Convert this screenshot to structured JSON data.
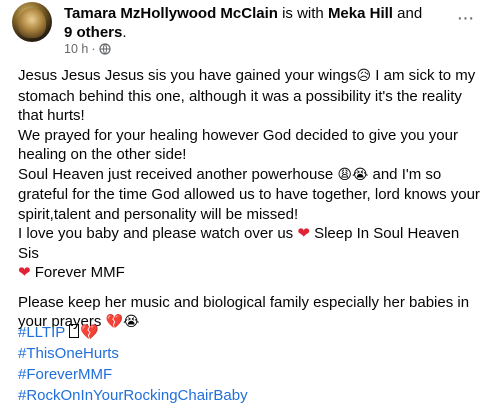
{
  "header": {
    "author": "Tamara MzHollywood McClain",
    "with_text": " is with ",
    "tagged_person": "Meka Hill",
    "and_text": " and",
    "others": "9 others",
    "period": ".",
    "time": "10 h",
    "separator": "·",
    "privacy_icon": "globe-icon",
    "more_icon": "more-options-icon",
    "more_label": "···"
  },
  "post": {
    "line1": "Jesus Jesus Jesus  sis you have gained your wings",
    "line1_emoji": "😥",
    "line1_rest": " I am sick to my stomach behind this one, although it was a possibility it's the reality that hurts!",
    "line2": "We prayed for your healing however God decided to give you your healing on the other side!",
    "line3_a": "Soul Heaven just received another powerhouse ",
    "line3_emoji": "😩😭",
    "line3_b": " and I'm so grateful for the time God allowed us to have together, lord knows your spirit,talent and personality will be missed!",
    "line4_a": " I love you baby and please watch over us ",
    "heart": "❤",
    "line4_b": " Sleep In Soul Heaven Sis ",
    "line4_c": " Forever MMF",
    "line5": "Please keep her music and biological family especially her babies in your prayers ",
    "line5_emoji": "💔😭"
  },
  "hashtags": [
    "#LLTIP",
    "#ThisOneHurts",
    "#ForeverMMF",
    "#RockOnInYourRockingChairBaby"
  ],
  "hashtag_suffix": "💔",
  "colors": {
    "link": "#216fdb",
    "heart": "#e02234",
    "meta": "#65676b"
  }
}
